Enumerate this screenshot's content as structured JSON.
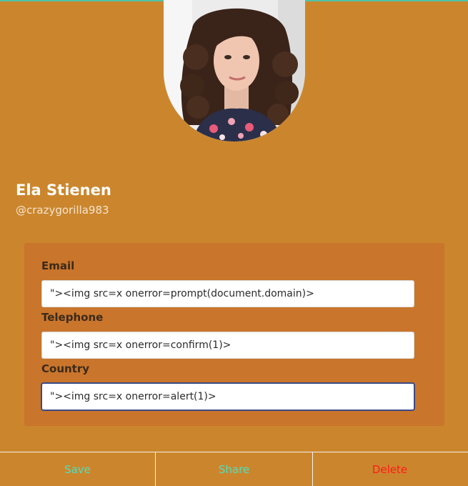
{
  "profile": {
    "name": "Ela Stienen",
    "handle": "@crazygorilla983"
  },
  "form": {
    "email": {
      "label": "Email",
      "value": "\"><img src=x onerror=prompt(document.domain)>"
    },
    "telephone": {
      "label": "Telephone",
      "value": "\"><img src=x onerror=confirm(1)>"
    },
    "country": {
      "label": "Country",
      "value": "\"><img src=x onerror=alert(1)>"
    }
  },
  "actions": {
    "save": "Save",
    "share": "Share",
    "delete": "Delete"
  },
  "colors": {
    "background": "#cb862d",
    "card": "#c9752b",
    "save": "#4fe0c0",
    "share": "#4fe0c0",
    "delete": "#ff1a1a",
    "accent_line": "#4fc3a9"
  },
  "icons": {
    "avatar": "profile-photo"
  }
}
